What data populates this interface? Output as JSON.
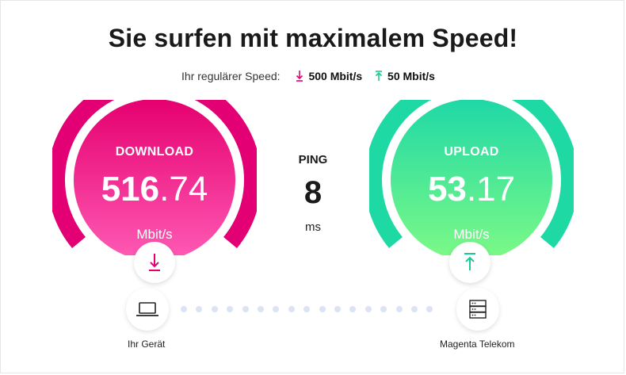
{
  "headline": "Sie surfen mit maximalem Speed!",
  "regular_speed": {
    "label": "Ihr regulärer Speed:",
    "download": "500 Mbit/s",
    "upload": "50 Mbit/s"
  },
  "download": {
    "title": "DOWNLOAD",
    "value_int": "516",
    "value_dec": ".74",
    "unit": "Mbit/s",
    "color_start": "#e5006f",
    "color_end": "#ff5bb5"
  },
  "ping": {
    "title": "PING",
    "value": "8",
    "unit": "ms"
  },
  "upload": {
    "title": "UPLOAD",
    "value_int": "53",
    "value_dec": ".17",
    "unit": "Mbit/s",
    "color_start": "#1fd8a6",
    "color_end": "#7dfa86"
  },
  "devices": {
    "client": {
      "label": "Ihr Gerät",
      "icon": "laptop-icon"
    },
    "server": {
      "label": "Magenta Telekom",
      "icon": "server-icon"
    }
  }
}
